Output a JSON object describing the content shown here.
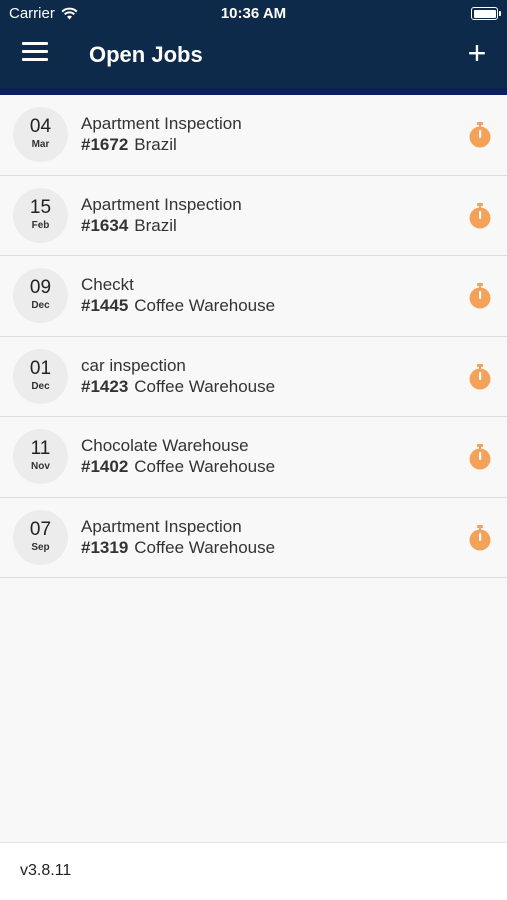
{
  "status_bar": {
    "carrier": "Carrier",
    "time": "10:36 AM"
  },
  "header": {
    "title": "Open Jobs",
    "add_label": "+"
  },
  "jobs": [
    {
      "day": "04",
      "month": "Mar",
      "title": "Apartment Inspection",
      "number": "#1672",
      "location": "Brazil"
    },
    {
      "day": "15",
      "month": "Feb",
      "title": "Apartment Inspection",
      "number": "#1634",
      "location": "Brazil"
    },
    {
      "day": "09",
      "month": "Dec",
      "title": "Checkt",
      "number": "#1445",
      "location": "Coffee Warehouse"
    },
    {
      "day": "01",
      "month": "Dec",
      "title": "car inspection",
      "number": "#1423",
      "location": "Coffee Warehouse"
    },
    {
      "day": "11",
      "month": "Nov",
      "title": "Chocolate Warehouse",
      "number": "#1402",
      "location": "Coffee Warehouse"
    },
    {
      "day": "07",
      "month": "Sep",
      "title": "Apartment Inspection",
      "number": "#1319",
      "location": "Coffee Warehouse"
    }
  ],
  "footer": {
    "version": "v3.8.11"
  },
  "colors": {
    "header_bg": "#0d2a4a",
    "accent_timer": "#f4a259"
  }
}
